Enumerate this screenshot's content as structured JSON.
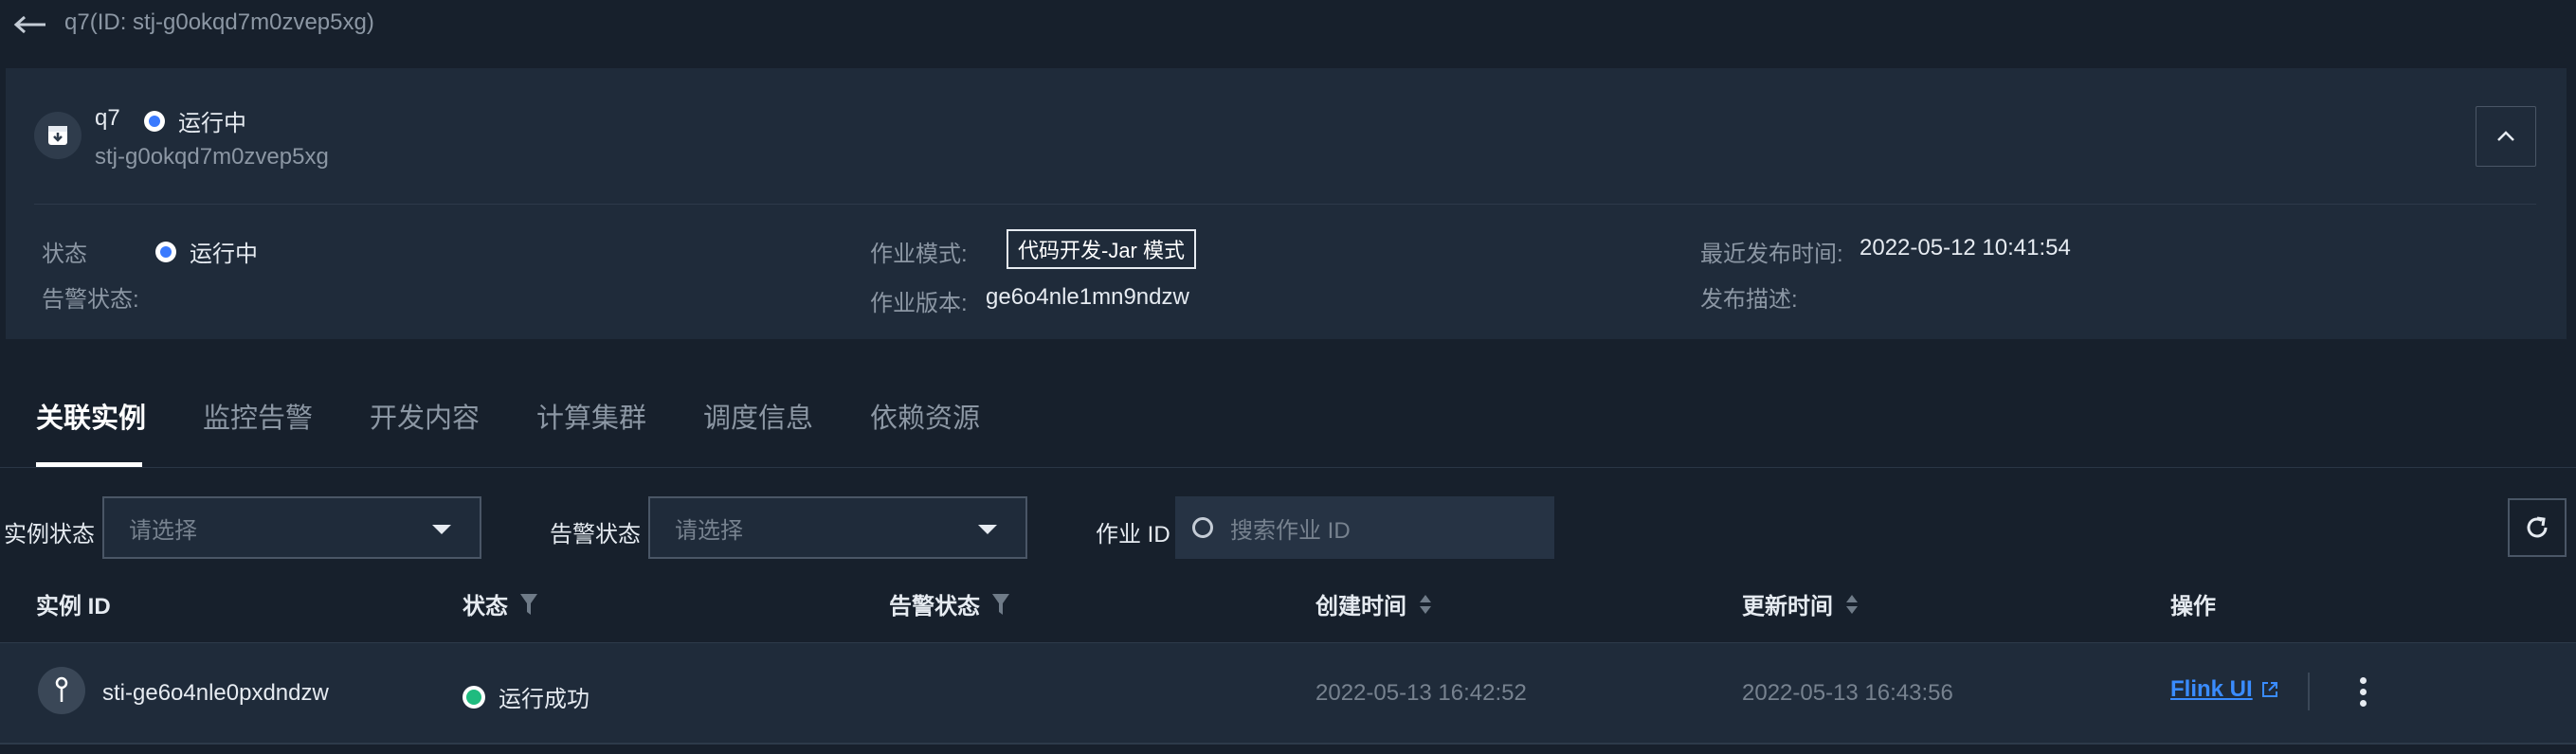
{
  "header": {
    "title": "q7(ID: stj-g0okqd7m0zvep5xg)"
  },
  "job": {
    "name": "q7",
    "status": "运行中",
    "id": "stj-g0okqd7m0zvep5xg",
    "fields": {
      "status_label": "状态",
      "status_value": "运行中",
      "alarm_label": "告警状态:",
      "mode_label": "作业模式:",
      "mode_value": "代码开发-Jar 模式",
      "version_label": "作业版本:",
      "version_value": "ge6o4nle1mn9ndzw",
      "publish_time_label": "最近发布时间:",
      "publish_time_value": "2022-05-12 10:41:54",
      "publish_desc_label": "发布描述:"
    }
  },
  "tabs": [
    {
      "label": "关联实例",
      "active": true
    },
    {
      "label": "监控告警"
    },
    {
      "label": "开发内容"
    },
    {
      "label": "计算集群"
    },
    {
      "label": "调度信息"
    },
    {
      "label": "依赖资源"
    }
  ],
  "filters": {
    "instance_status_label": "实例状态",
    "instance_status_placeholder": "请选择",
    "alarm_status_label": "告警状态",
    "alarm_status_placeholder": "请选择",
    "job_id_label": "作业 ID",
    "job_id_placeholder": "搜索作业 ID"
  },
  "table": {
    "columns": [
      "实例 ID",
      "状态",
      "告警状态",
      "创建时间",
      "更新时间",
      "操作"
    ],
    "rows": [
      {
        "instance_id": "sti-ge6o4nle0pxdndzw",
        "status": "运行成功",
        "alarm_status": "",
        "created": "2022-05-13 16:42:52",
        "updated": "2022-05-13 16:43:56",
        "action": "Flink UI"
      }
    ]
  },
  "colors": {
    "background": "#17202c",
    "card": "#1f2b3a",
    "accent_blue": "#3a7afe",
    "link": "#3a8cff",
    "success": "#1fbb7f"
  },
  "icons": [
    "back-arrow-icon",
    "job-icon",
    "chevron-up-icon",
    "caret-down-icon",
    "search-icon",
    "refresh-icon",
    "filter-icon",
    "sort-icon",
    "instance-icon",
    "external-link-icon",
    "more-icon"
  ]
}
